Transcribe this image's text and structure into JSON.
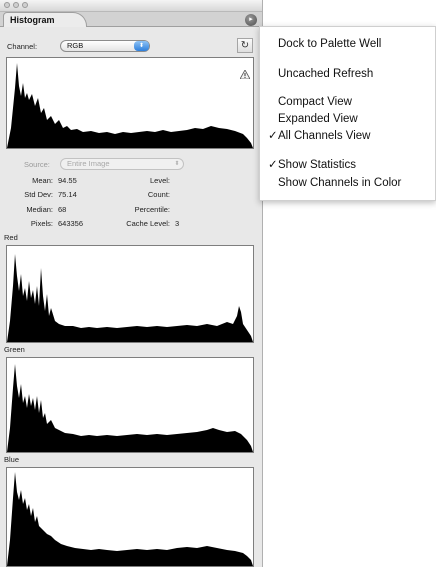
{
  "panel": {
    "tab_label": "Histogram",
    "menu_glyph": "▸",
    "channel_label": "Channel:",
    "channel_value": "RGB",
    "select_arrows": "⬍",
    "refresh_glyph": "↻",
    "warning_icon": "warning-icon",
    "source_label": "Source:",
    "source_value": "Entire Image",
    "stats": {
      "mean_label": "Mean:",
      "mean_value": "94.55",
      "std_label": "Std Dev:",
      "std_value": "75.14",
      "median_label": "Median:",
      "median_value": "68",
      "pixels_label": "Pixels:",
      "pixels_value": "643356",
      "level_label": "Level:",
      "count_label": "Count:",
      "percentile_label": "Percentile:",
      "cache_label": "Cache Level:",
      "cache_value": "3"
    },
    "channels": [
      {
        "label": "Red"
      },
      {
        "label": "Green"
      },
      {
        "label": "Blue"
      }
    ]
  },
  "menu": {
    "items": [
      {
        "label": "Dock to Palette Well",
        "checked": false
      },
      {
        "label": "Uncached Refresh",
        "checked": false
      },
      {
        "label": "Compact View",
        "checked": false
      },
      {
        "label": "Expanded View",
        "checked": false
      },
      {
        "label": "All Channels View",
        "checked": true
      },
      {
        "label": "Show Statistics",
        "checked": true
      },
      {
        "label": "Show Channels in Color",
        "checked": false
      }
    ],
    "check_glyph": "✓"
  }
}
